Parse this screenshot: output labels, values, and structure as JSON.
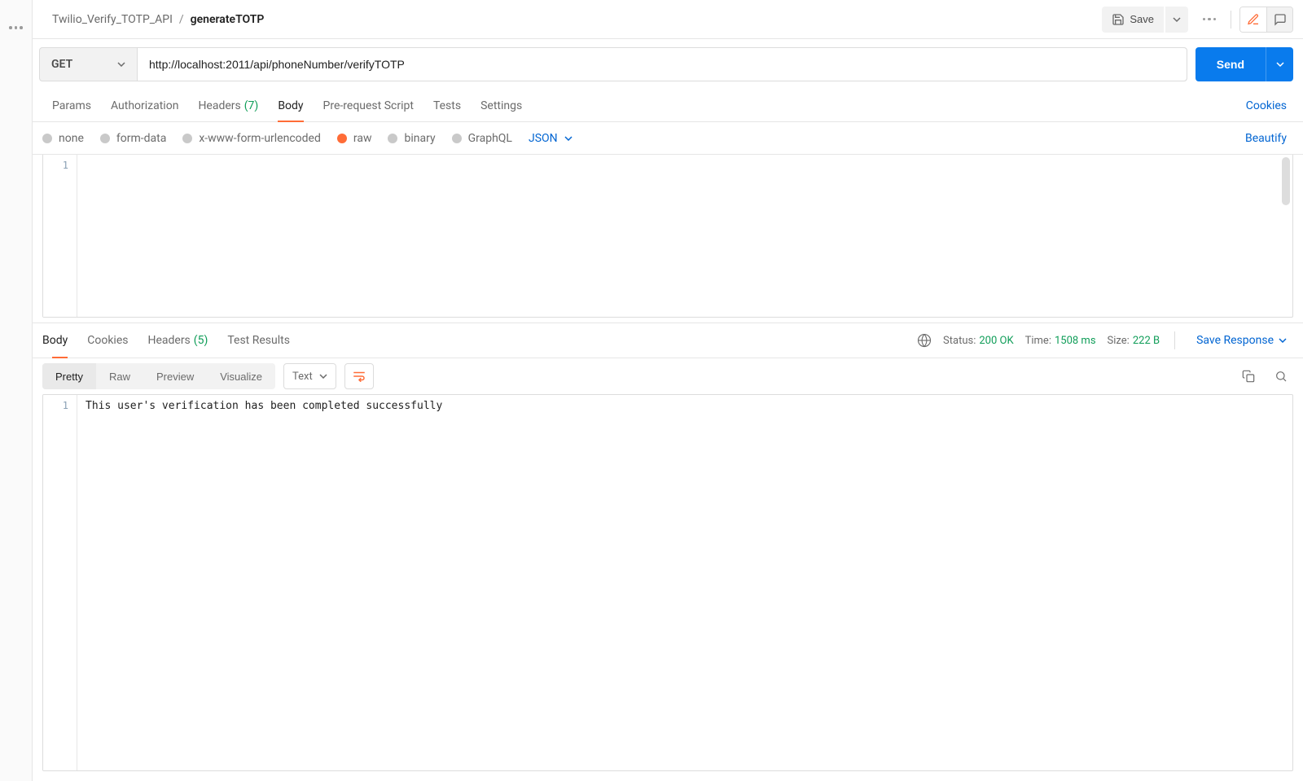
{
  "breadcrumbs": {
    "collection": "Twilio_Verify_TOTP_API",
    "request": "generateTOTP"
  },
  "header_actions": {
    "save": "Save"
  },
  "request": {
    "method": "GET",
    "url": "http://localhost:2011/api/phoneNumber/verifyTOTP",
    "send_label": "Send"
  },
  "request_tabs": {
    "params": "Params",
    "authorization": "Authorization",
    "headers": "Headers",
    "headers_count": "(7)",
    "body": "Body",
    "prerequest": "Pre-request Script",
    "tests": "Tests",
    "settings": "Settings",
    "cookies_link": "Cookies"
  },
  "body_types": {
    "none": "none",
    "form_data": "form-data",
    "xwww": "x-www-form-urlencoded",
    "raw": "raw",
    "binary": "binary",
    "graphql": "GraphQL",
    "format": "JSON",
    "beautify": "Beautify"
  },
  "request_body_lines": {
    "ln1": "1"
  },
  "response_tabs": {
    "body": "Body",
    "cookies": "Cookies",
    "headers": "Headers",
    "headers_count": "(5)",
    "test_results": "Test Results"
  },
  "response_status": {
    "status_label": "Status:",
    "status_value": "200 OK",
    "time_label": "Time:",
    "time_value": "1508 ms",
    "size_label": "Size:",
    "size_value": "222 B",
    "save_response": "Save Response"
  },
  "response_views": {
    "pretty": "Pretty",
    "raw": "Raw",
    "preview": "Preview",
    "visualize": "Visualize",
    "format": "Text"
  },
  "response_body": {
    "ln1_num": "1",
    "ln1_text": "This user's verification has been completed successfully"
  }
}
